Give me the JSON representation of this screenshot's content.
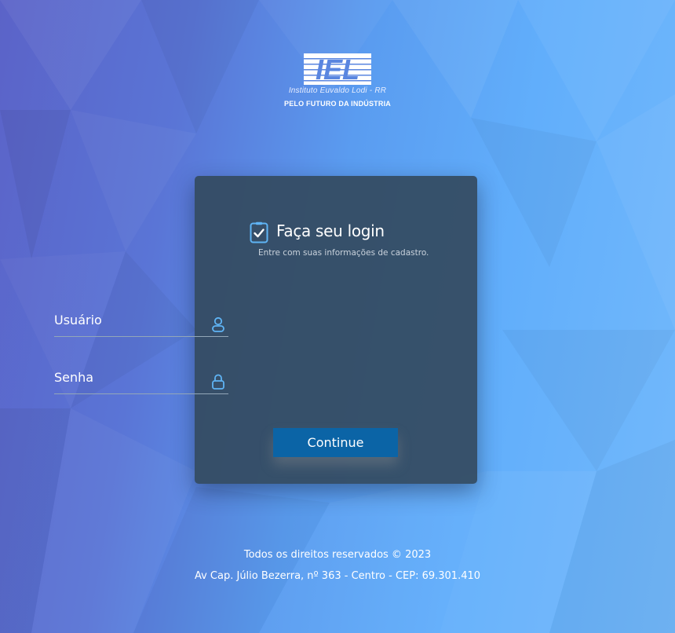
{
  "logo": {
    "mark_text": "IEL",
    "subtitle": "Instituto Euvaldo Lodi - RR",
    "slogan": "PELO FUTURO DA INDÚSTRIA"
  },
  "login": {
    "title": "Faça seu login",
    "subtitle": "Entre com suas informações de cadastro.",
    "title_icon": "clipboard-check-icon",
    "username": {
      "placeholder": "Usuário",
      "value": "",
      "icon": "user-icon"
    },
    "password": {
      "placeholder": "Senha",
      "value": "",
      "icon": "lock-icon"
    },
    "continue_label": "Continue"
  },
  "footer": {
    "rights": "Todos os direitos reservados © 2023",
    "address": "Av Cap. Júlio Bezerra, nº 363 - Centro - CEP: 69.301.410"
  },
  "colors": {
    "button": "#0b64a6",
    "card": "#344a60",
    "icon_accent": "#5fb4f5"
  }
}
